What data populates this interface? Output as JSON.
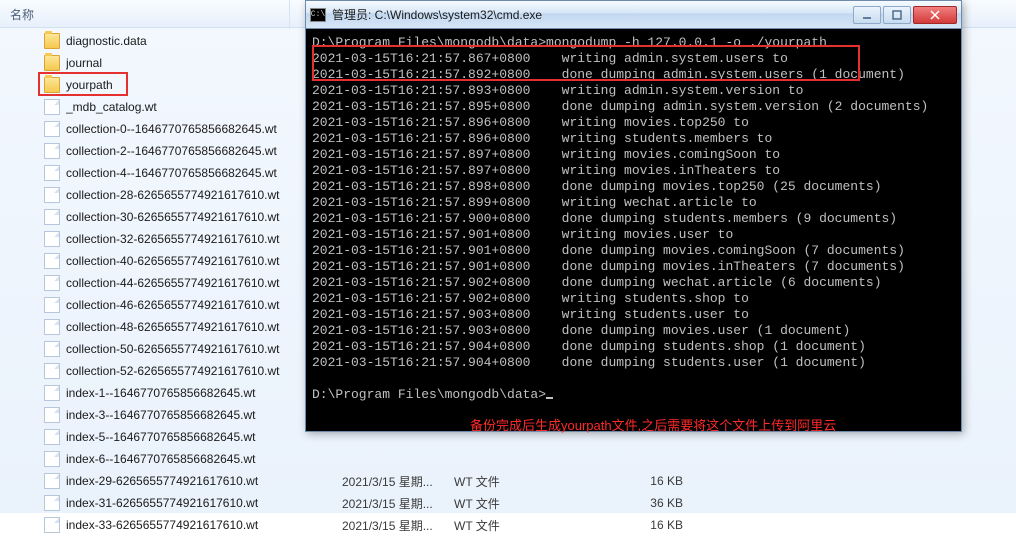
{
  "explorer": {
    "columns": {
      "name": "名称",
      "date": "",
      "type": "",
      "size": ""
    },
    "items": [
      {
        "kind": "folder",
        "name": "diagnostic.data"
      },
      {
        "kind": "folder",
        "name": "journal"
      },
      {
        "kind": "folder",
        "name": "yourpath",
        "highlighted": true
      },
      {
        "kind": "file",
        "name": "_mdb_catalog.wt"
      },
      {
        "kind": "file",
        "name": "collection-0--1646770765856682645.wt"
      },
      {
        "kind": "file",
        "name": "collection-2--1646770765856682645.wt"
      },
      {
        "kind": "file",
        "name": "collection-4--1646770765856682645.wt"
      },
      {
        "kind": "file",
        "name": "collection-28-6265655774921617610.wt"
      },
      {
        "kind": "file",
        "name": "collection-30-6265655774921617610.wt"
      },
      {
        "kind": "file",
        "name": "collection-32-6265655774921617610.wt"
      },
      {
        "kind": "file",
        "name": "collection-40-6265655774921617610.wt"
      },
      {
        "kind": "file",
        "name": "collection-44-6265655774921617610.wt"
      },
      {
        "kind": "file",
        "name": "collection-46-6265655774921617610.wt"
      },
      {
        "kind": "file",
        "name": "collection-48-6265655774921617610.wt"
      },
      {
        "kind": "file",
        "name": "collection-50-6265655774921617610.wt"
      },
      {
        "kind": "file",
        "name": "collection-52-6265655774921617610.wt"
      },
      {
        "kind": "file",
        "name": "index-1--1646770765856682645.wt"
      },
      {
        "kind": "file",
        "name": "index-3--1646770765856682645.wt"
      },
      {
        "kind": "file",
        "name": "index-5--1646770765856682645.wt"
      },
      {
        "kind": "file",
        "name": "index-6--1646770765856682645.wt"
      },
      {
        "kind": "file",
        "name": "index-29-6265655774921617610.wt",
        "date": "2021/3/15 星期...",
        "type": "WT 文件",
        "size": "16 KB"
      },
      {
        "kind": "file",
        "name": "index-31-6265655774921617610.wt",
        "date": "2021/3/15 星期...",
        "type": "WT 文件",
        "size": "36 KB"
      },
      {
        "kind": "file",
        "name": "index-33-6265655774921617610.wt",
        "date": "2021/3/15 星期...",
        "type": "WT 文件",
        "size": "16 KB"
      }
    ]
  },
  "cmd": {
    "title": "管理员: C:\\Windows\\system32\\cmd.exe",
    "icon_text": "C:\\",
    "prompt_path": "D:\\Program Files\\mongodb\\data>",
    "command": "mongodump -h 127.0.0.1 -o ./yourpath",
    "lines": [
      "2021-03-15T16:21:57.867+0800    writing admin.system.users to",
      "2021-03-15T16:21:57.892+0800    done dumping admin.system.users (1 document)",
      "2021-03-15T16:21:57.893+0800    writing admin.system.version to",
      "2021-03-15T16:21:57.895+0800    done dumping admin.system.version (2 documents)",
      "2021-03-15T16:21:57.896+0800    writing movies.top250 to",
      "2021-03-15T16:21:57.896+0800    writing students.members to",
      "2021-03-15T16:21:57.897+0800    writing movies.comingSoon to",
      "2021-03-15T16:21:57.897+0800    writing movies.inTheaters to",
      "2021-03-15T16:21:57.898+0800    done dumping movies.top250 (25 documents)",
      "2021-03-15T16:21:57.899+0800    writing wechat.article to",
      "2021-03-15T16:21:57.900+0800    done dumping students.members (9 documents)",
      "2021-03-15T16:21:57.901+0800    writing movies.user to",
      "2021-03-15T16:21:57.901+0800    done dumping movies.comingSoon (7 documents)",
      "2021-03-15T16:21:57.901+0800    done dumping movies.inTheaters (7 documents)",
      "2021-03-15T16:21:57.902+0800    done dumping wechat.article (6 documents)",
      "2021-03-15T16:21:57.902+0800    writing students.shop to",
      "2021-03-15T16:21:57.903+0800    writing students.user to",
      "2021-03-15T16:21:57.903+0800    done dumping movies.user (1 document)",
      "2021-03-15T16:21:57.904+0800    done dumping students.shop (1 document)",
      "2021-03-15T16:21:57.904+0800    done dumping students.user (1 document)"
    ],
    "final_prompt": "D:\\Program Files\\mongodb\\data>"
  },
  "annotation": "备份完成后生成yourpath文件,之后需要将这个文件上传到阿里云"
}
